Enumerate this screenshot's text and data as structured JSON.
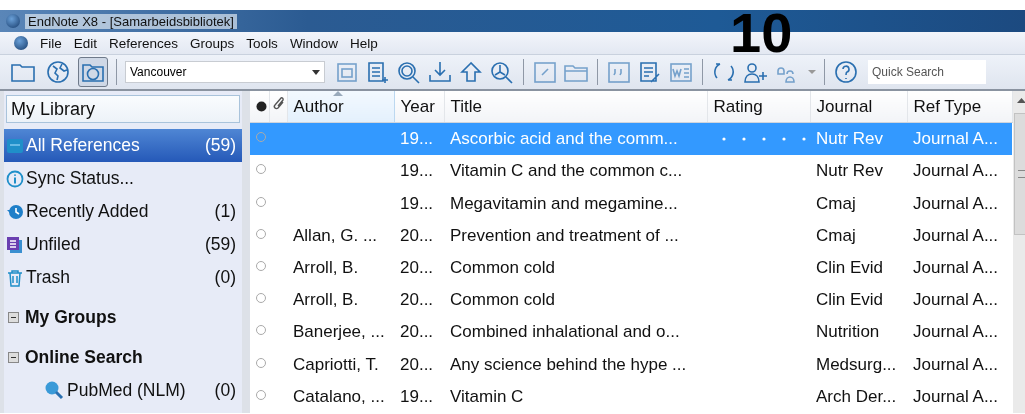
{
  "window": {
    "title": "EndNote X8 - [Samarbeidsbibliotek]"
  },
  "overlay_label": "10",
  "menu": [
    "File",
    "Edit",
    "References",
    "Groups",
    "Tools",
    "Window",
    "Help"
  ],
  "toolbar": {
    "mode_buttons": [
      {
        "selected": false
      },
      {
        "selected": false
      },
      {
        "selected": true
      }
    ],
    "style": "Vancouver",
    "search": {
      "placeholder": "Quick Search"
    }
  },
  "sidebar": {
    "header": "My Library",
    "items": [
      {
        "kind": "all",
        "label": "All References",
        "count": "(59)",
        "selected": true
      },
      {
        "kind": "sync",
        "label": "Sync Status...",
        "selected": false
      },
      {
        "kind": "recent",
        "label": "Recently Added",
        "count": "(1)",
        "selected": false
      },
      {
        "kind": "unfiled",
        "label": "Unfiled",
        "count": "(59)",
        "selected": false
      },
      {
        "kind": "trash",
        "label": "Trash",
        "count": "(0)",
        "selected": false
      }
    ],
    "groups": [
      {
        "label": "My Groups",
        "expanded": true
      },
      {
        "label": "Online Search",
        "expanded": true,
        "children": [
          {
            "label": "PubMed (NLM)",
            "count": "(0)"
          }
        ]
      }
    ]
  },
  "table": {
    "columns": [
      "Author",
      "Year",
      "Title",
      "Rating",
      "Journal",
      "Ref Type"
    ],
    "rows": [
      {
        "author": "",
        "year": "19...",
        "title": "Ascorbic acid and the comm...",
        "journal": "Nutr Rev",
        "ref_type": "Journal A...",
        "selected": true
      },
      {
        "author": "",
        "year": "19...",
        "title": "Vitamin C and the common c...",
        "journal": "Nutr Rev",
        "ref_type": "Journal A...",
        "selected": false
      },
      {
        "author": "",
        "year": "19...",
        "title": "Megavitamin and megamine...",
        "journal": "Cmaj",
        "ref_type": "Journal A...",
        "selected": false
      },
      {
        "author": "Allan, G. ...",
        "year": "20...",
        "title": "Prevention and treatment of ...",
        "journal": "Cmaj",
        "ref_type": "Journal A...",
        "selected": false
      },
      {
        "author": "Arroll, B.",
        "year": "20...",
        "title": "Common cold",
        "journal": "Clin Evid",
        "ref_type": "Journal A...",
        "selected": false
      },
      {
        "author": "Arroll, B.",
        "year": "20...",
        "title": "Common cold",
        "journal": "Clin Evid",
        "ref_type": "Journal A...",
        "selected": false
      },
      {
        "author": "Banerjee, ...",
        "year": "20...",
        "title": "Combined inhalational and o...",
        "journal": "Nutrition",
        "ref_type": "Journal A...",
        "selected": false
      },
      {
        "author": "Capriotti, T.",
        "year": "20...",
        "title": "Any science behind the hype ...",
        "journal": "Medsurg...",
        "ref_type": "Journal A...",
        "selected": false
      },
      {
        "author": "Catalano, ...",
        "year": "19...",
        "title": "Vitamin C",
        "journal": "Arch Der...",
        "ref_type": "Journal A...",
        "selected": false
      }
    ]
  }
}
